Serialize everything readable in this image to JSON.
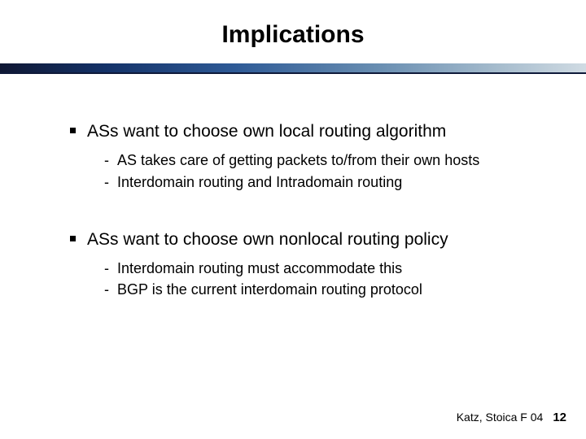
{
  "title": "Implications",
  "points": [
    {
      "text": "ASs want to choose own local routing algorithm",
      "subs": [
        "AS takes care of getting packets to/from their own hosts",
        "Interdomain routing and Intradomain routing"
      ]
    },
    {
      "text": "ASs want to choose own nonlocal routing policy",
      "subs": [
        "Interdomain routing must accommodate this",
        "BGP is the current interdomain routing protocol"
      ]
    }
  ],
  "footer": {
    "credit": "Katz, Stoica F 04",
    "page": "12"
  }
}
